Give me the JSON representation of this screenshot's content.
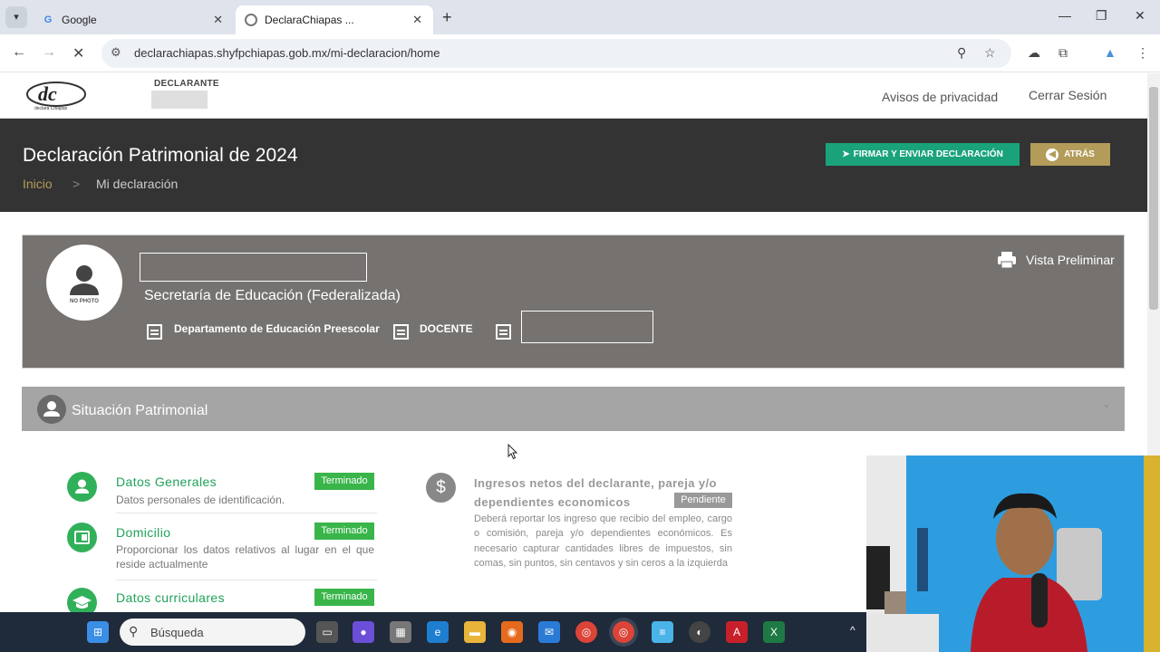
{
  "browser": {
    "tabs": [
      {
        "title": "Google",
        "active": false
      },
      {
        "title": "DeclaraChiapas ...",
        "active": true
      }
    ],
    "url": "declarachiapas.shyfpchiapas.gob.mx/mi-declaracion/home"
  },
  "site": {
    "logo_text": "dc",
    "logo_sub": "declara Chiapas",
    "declarante_label": "DECLARANTE",
    "nav": {
      "privacy": "Avisos de privacidad",
      "logout": "Cerrar Sesión"
    }
  },
  "banner": {
    "title": "Declaración Patrimonial de 2024",
    "breadcrumb": {
      "home": "Inicio",
      "separator": ">",
      "current": "Mi declaración"
    },
    "sign_button": "FIRMAR Y ENVIAR DECLARACIÓN",
    "back_button": "ATRÁS"
  },
  "profile": {
    "photo_text": "NO PHOTO",
    "department": "Secretaría de Educación (Federalizada)",
    "area": "Departamento de Educación Preescolar",
    "position": "DOCENTE",
    "preview": "Vista Preliminar"
  },
  "section": {
    "title": "Situación Patrimonial"
  },
  "items": [
    {
      "title": "Datos Generales",
      "desc": "Datos personales de identificación.",
      "status": "Terminado"
    },
    {
      "title": "Domicilio",
      "desc": "Proporcionar los datos relativos al lugar en el que reside actualmente",
      "status": "Terminado"
    },
    {
      "title": "Datos curriculares",
      "desc": "",
      "status": "Terminado"
    }
  ],
  "income": {
    "title": "Ingresos netos del declarante, pareja y/o dependientes economicos",
    "status": "Pendiente",
    "desc": "Deberá reportar los ingreso que recibio del empleo, cargo o comisión, pareja y/o dependientes económicos. Es necesario capturar cantidades libres de impuestos, sin comas, sin puntos, sin centavos y sin ceros a la izquierda"
  },
  "taskbar": {
    "search_label": "Búsqueda"
  },
  "colors": {
    "banner": "#333333",
    "green": "#1aa37a",
    "gold": "#b39b5a",
    "status_green": "#39b54a",
    "card_gray": "#757270"
  }
}
